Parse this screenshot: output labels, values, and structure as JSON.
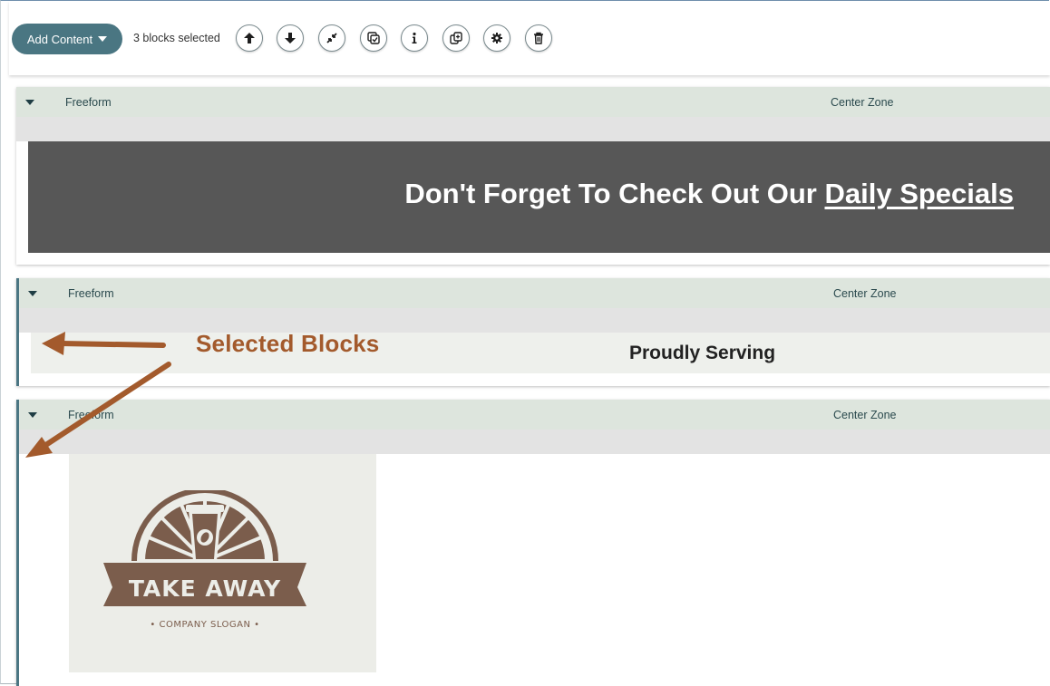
{
  "toolbar": {
    "add_content_label": "Add Content",
    "selection_text": "3 blocks selected",
    "buttons": [
      {
        "name": "move-up-button",
        "icon": "arrow-up-icon"
      },
      {
        "name": "move-down-button",
        "icon": "arrow-down-icon"
      },
      {
        "name": "collapse-button",
        "icon": "collapse-arrows-icon"
      },
      {
        "name": "select-all-button",
        "icon": "checkbox-copy-icon"
      },
      {
        "name": "info-button",
        "icon": "info-icon"
      },
      {
        "name": "duplicate-button",
        "icon": "duplicate-icon"
      },
      {
        "name": "settings-button",
        "icon": "gear-icon"
      },
      {
        "name": "delete-button",
        "icon": "trash-icon"
      }
    ]
  },
  "blocks": [
    {
      "type": "Freeform",
      "zone": "Center Zone",
      "selected": false,
      "content": {
        "text_before": "Don't Forget To Check Out Our ",
        "link_text": "Daily Specials"
      }
    },
    {
      "type": "Freeform",
      "zone": "Center Zone",
      "selected": true,
      "content": {
        "text": "Proudly Serving"
      }
    },
    {
      "type": "Freeform",
      "zone": "Center Zone",
      "selected": true,
      "content": {
        "logo_title": "TAKE AWAY",
        "logo_slogan": "• COMPANY SLOGAN •"
      }
    }
  ],
  "annotation": {
    "label": "Selected Blocks",
    "color": "#a35a2c"
  },
  "colors": {
    "accent": "#4a7682",
    "header_bg": "#dde5dd",
    "banner_bg": "#575757",
    "logo_brown": "#7b5d4c"
  }
}
